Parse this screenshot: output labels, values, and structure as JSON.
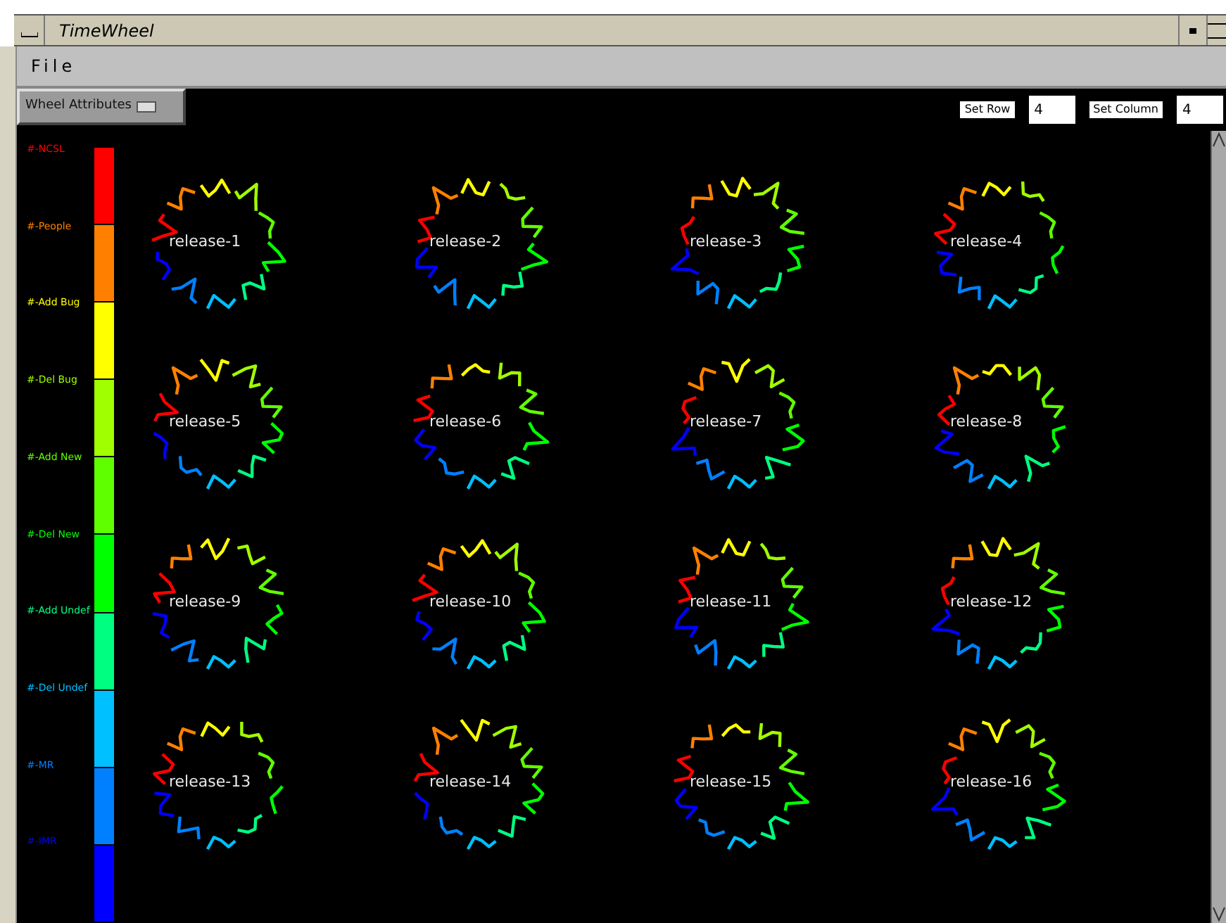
{
  "window": {
    "title": "TimeWheel"
  },
  "menu": [
    "File"
  ],
  "toolbar": {
    "attributes_button": "Wheel Attributes",
    "row_label": "Set Row",
    "row_value": "4",
    "column_label": "Set Column",
    "column_value": "4"
  },
  "legend": [
    {
      "label": "#-NCSL",
      "color": "#ff0000"
    },
    {
      "label": "#-People",
      "color": "#ff8000"
    },
    {
      "label": "#-Add Bug",
      "color": "#ffff00"
    },
    {
      "label": "#-Del Bug",
      "color": "#a0ff00"
    },
    {
      "label": "#-Add New",
      "color": "#60ff00"
    },
    {
      "label": "#-Del New",
      "color": "#00ff00"
    },
    {
      "label": "#-Add Undef",
      "color": "#00ff80"
    },
    {
      "label": "#-Del Undef",
      "color": "#00c0ff"
    },
    {
      "label": "#-MR",
      "color": "#0080ff"
    },
    {
      "label": "#-IMR",
      "color": "#0000ff"
    }
  ],
  "wheels": [
    {
      "label": "release-1"
    },
    {
      "label": "release-2"
    },
    {
      "label": "release-3"
    },
    {
      "label": "release-4"
    },
    {
      "label": "release-5"
    },
    {
      "label": "release-6"
    },
    {
      "label": "release-7"
    },
    {
      "label": "release-8"
    },
    {
      "label": "release-9"
    },
    {
      "label": "release-10"
    },
    {
      "label": "release-11"
    },
    {
      "label": "release-12"
    },
    {
      "label": "release-13"
    },
    {
      "label": "release-14"
    },
    {
      "label": "release-15"
    },
    {
      "label": "release-16"
    }
  ]
}
